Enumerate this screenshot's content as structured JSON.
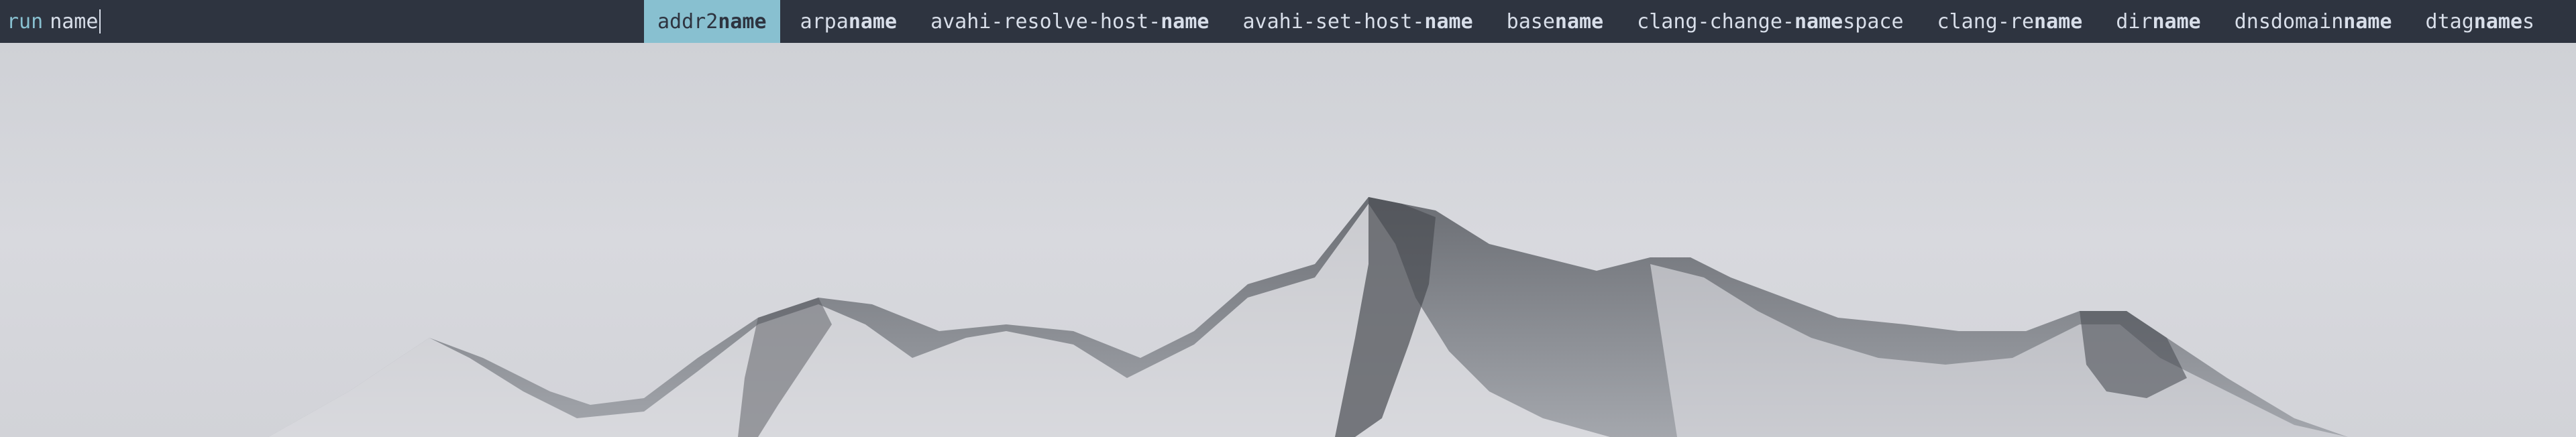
{
  "launcher": {
    "prompt": "run",
    "query": "name",
    "selected_index": 0,
    "items": [
      {
        "pre": "addr2",
        "match": "name",
        "post": ""
      },
      {
        "pre": "arpa",
        "match": "name",
        "post": ""
      },
      {
        "pre": "avahi-resolve-host-",
        "match": "name",
        "post": ""
      },
      {
        "pre": "avahi-set-host-",
        "match": "name",
        "post": ""
      },
      {
        "pre": "base",
        "match": "name",
        "post": ""
      },
      {
        "pre": "clang-change-",
        "match": "name",
        "post": "space"
      },
      {
        "pre": "clang-re",
        "match": "name",
        "post": ""
      },
      {
        "pre": "dir",
        "match": "name",
        "post": ""
      },
      {
        "pre": "dnsdomain",
        "match": "name",
        "post": ""
      },
      {
        "pre": "dtag",
        "match": "name",
        "post": "s"
      }
    ]
  },
  "colors": {
    "bar_background": "#2e3440",
    "text": "#d8dee9",
    "accent": "#88c0d0"
  }
}
